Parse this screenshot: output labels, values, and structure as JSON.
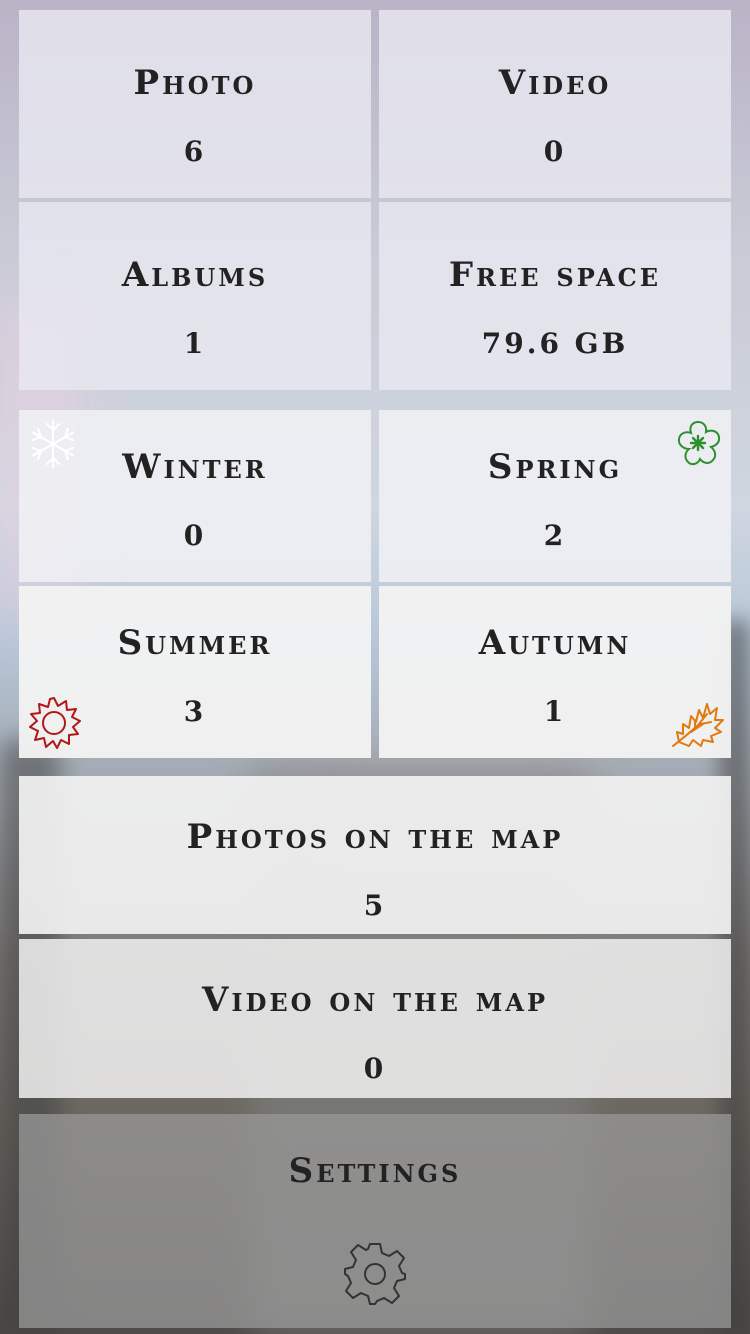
{
  "stats": {
    "photo": {
      "label": "Photo",
      "value": "6"
    },
    "video": {
      "label": "Video",
      "value": "0"
    },
    "albums": {
      "label": "Albums",
      "value": "1"
    },
    "free_space": {
      "label": "Free space",
      "value": "79.6 GB"
    }
  },
  "seasons": {
    "winter": {
      "label": "Winter",
      "value": "0",
      "icon": "snowflake-icon",
      "color": "#ffffff"
    },
    "spring": {
      "label": "Spring",
      "value": "2",
      "icon": "flower-icon",
      "color": "#3a9a3a"
    },
    "summer": {
      "label": "Summer",
      "value": "3",
      "icon": "sun-icon",
      "color": "#b01818"
    },
    "autumn": {
      "label": "Autumn",
      "value": "1",
      "icon": "leaf-icon",
      "color": "#e07a10"
    }
  },
  "map": {
    "photos": {
      "label": "Photos on the map",
      "value": "5"
    },
    "videos": {
      "label": "Video on the map",
      "value": "0"
    }
  },
  "settings": {
    "label": "Settings",
    "icon": "gear-icon"
  }
}
